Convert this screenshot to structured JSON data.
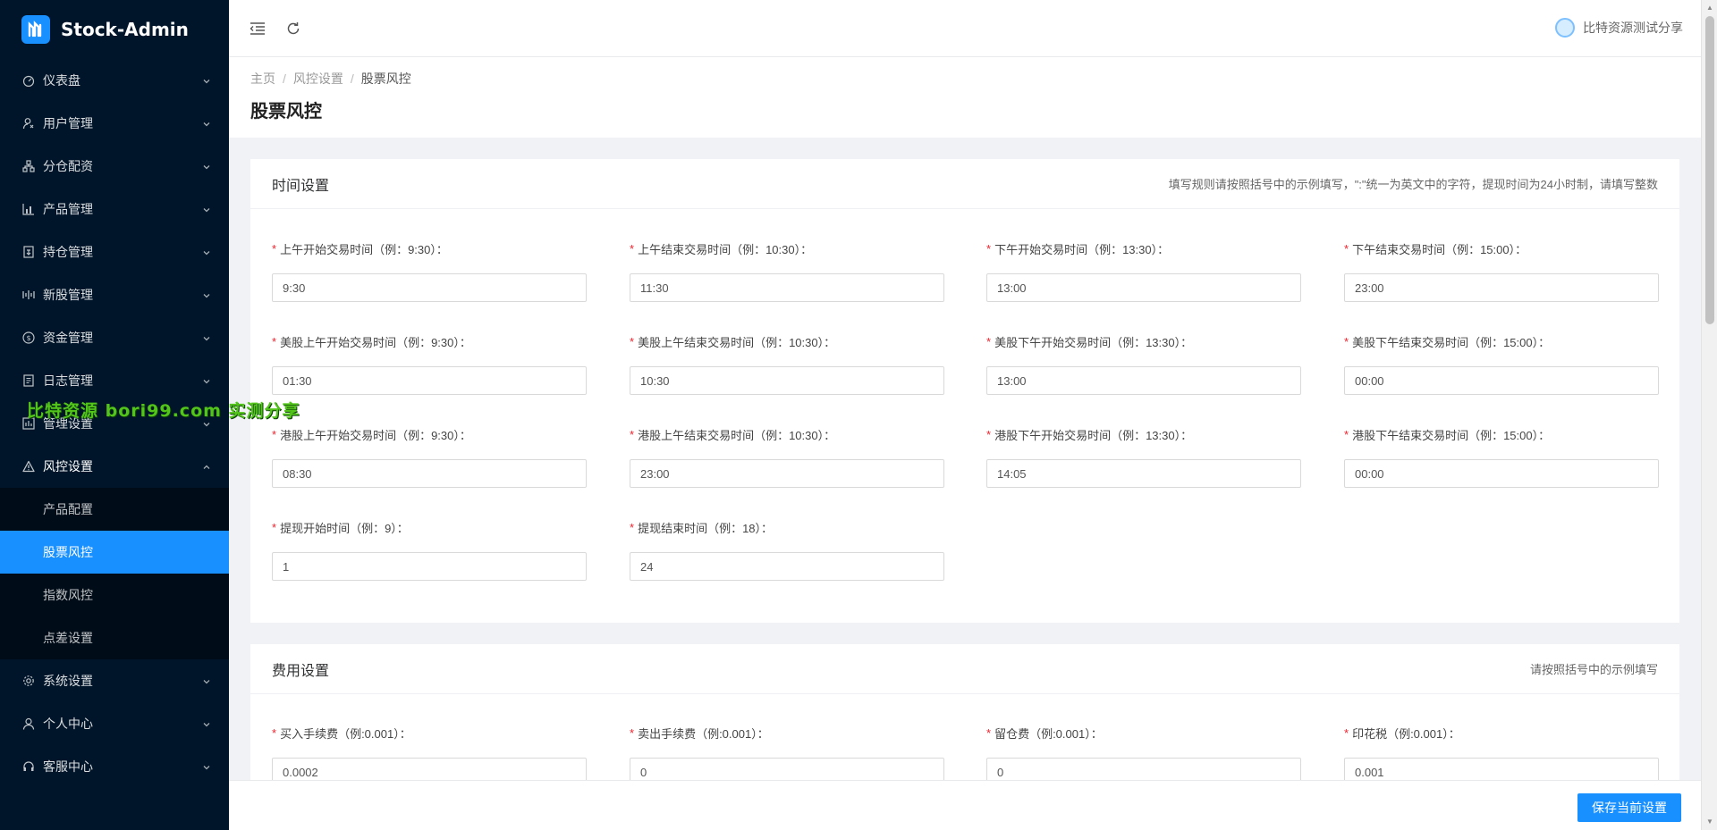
{
  "app": {
    "title": "Stock-Admin"
  },
  "sidebar": {
    "items": [
      {
        "label": "仪表盘",
        "icon": "dashboard-icon"
      },
      {
        "label": "用户管理",
        "icon": "user-manage-icon"
      },
      {
        "label": "分仓配资",
        "icon": "branch-icon"
      },
      {
        "label": "产品管理",
        "icon": "chart-icon"
      },
      {
        "label": "持仓管理",
        "icon": "position-icon"
      },
      {
        "label": "新股管理",
        "icon": "ipo-icon"
      },
      {
        "label": "资金管理",
        "icon": "money-icon"
      },
      {
        "label": "日志管理",
        "icon": "log-icon"
      },
      {
        "label": "管理设置",
        "icon": "admin-icon"
      },
      {
        "label": "风控设置",
        "icon": "warning-icon"
      }
    ],
    "risk_sub": [
      {
        "label": "产品配置"
      },
      {
        "label": "股票风控"
      },
      {
        "label": "指数风控"
      },
      {
        "label": "点差设置"
      }
    ],
    "bottom_items": [
      {
        "label": "系统设置",
        "icon": "gear-icon"
      },
      {
        "label": "个人中心",
        "icon": "person-icon"
      },
      {
        "label": "客服中心",
        "icon": "headset-icon"
      }
    ]
  },
  "watermark": "比特资源 bori99.com 实测分享",
  "header": {
    "username": "比特资源测试分享"
  },
  "breadcrumb": {
    "home": "主页",
    "parent": "风控设置",
    "current": "股票风控"
  },
  "page": {
    "title": "股票风控"
  },
  "time_card": {
    "title": "时间设置",
    "hint": "填写规则请按照括号中的示例填写，\":\"统一为英文中的字符，提现时间为24小时制，请填写整数",
    "fields": [
      {
        "label": "上午开始交易时间（例：9:30）：",
        "value": "9:30"
      },
      {
        "label": "上午结束交易时间（例：10:30）：",
        "value": "11:30"
      },
      {
        "label": "下午开始交易时间（例：13:30）：",
        "value": "13:00"
      },
      {
        "label": "下午结束交易时间（例：15:00）：",
        "value": "23:00"
      },
      {
        "label": "美股上午开始交易时间（例：9:30）：",
        "value": "01:30"
      },
      {
        "label": "美股上午结束交易时间（例：10:30）：",
        "value": "10:30"
      },
      {
        "label": "美股下午开始交易时间（例：13:30）：",
        "value": "13:00"
      },
      {
        "label": "美股下午结束交易时间（例：15:00）：",
        "value": "00:00"
      },
      {
        "label": "港股上午开始交易时间（例：9:30）：",
        "value": "08:30"
      },
      {
        "label": "港股上午结束交易时间（例：10:30）：",
        "value": "23:00"
      },
      {
        "label": "港股下午开始交易时间（例：13:30）：",
        "value": "14:05"
      },
      {
        "label": "港股下午结束交易时间（例：15:00）：",
        "value": "00:00"
      },
      {
        "label": "提现开始时间（例：9）：",
        "value": "1"
      },
      {
        "label": "提现结束时间（例：18）：",
        "value": "24"
      }
    ]
  },
  "fee_card": {
    "title": "费用设置",
    "hint": "请按照括号中的示例填写",
    "fields": [
      {
        "label": "买入手续费（例:0.001）：",
        "value": "0.0002"
      },
      {
        "label": "卖出手续费（例:0.001）：",
        "value": "0"
      },
      {
        "label": "留仓费（例:0.001）：",
        "value": "0"
      },
      {
        "label": "印花税（例:0.001）：",
        "value": "0.001"
      }
    ]
  },
  "footer": {
    "save_label": "保存当前设置"
  },
  "colors": {
    "sidebar_bg": "#001529",
    "accent": "#1890ff",
    "required": "#f5222d"
  }
}
